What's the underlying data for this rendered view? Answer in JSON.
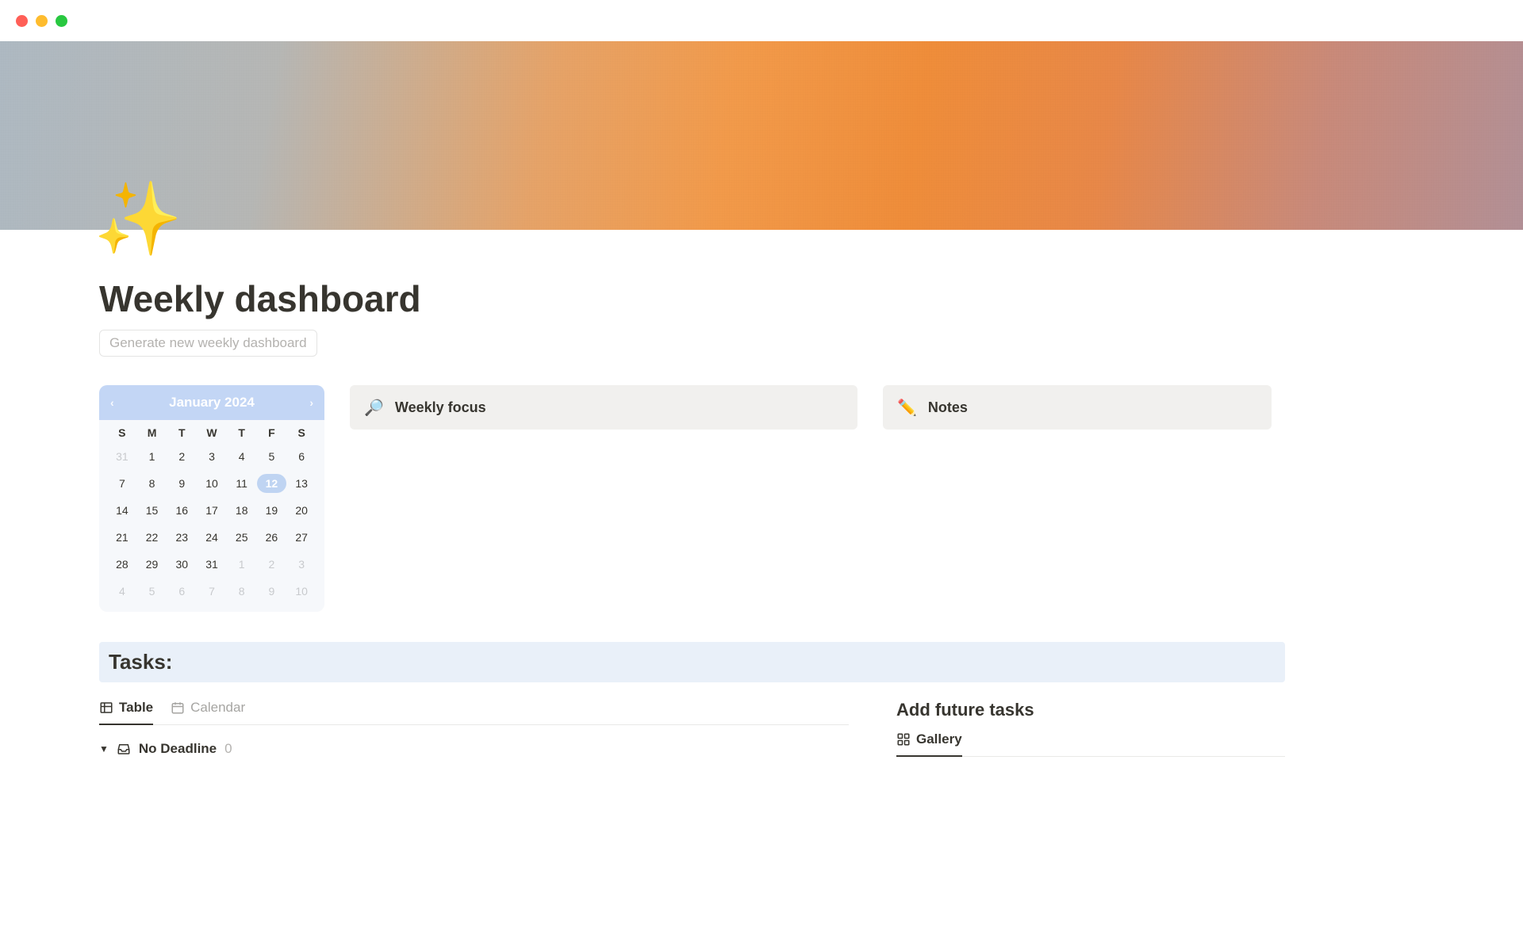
{
  "page": {
    "icon": "✨",
    "title": "Weekly dashboard",
    "generate_label": "Generate new weekly dashboard"
  },
  "calendar": {
    "month_label": "January 2024",
    "dow": [
      "S",
      "M",
      "T",
      "W",
      "T",
      "F",
      "S"
    ],
    "cells": [
      {
        "n": "31",
        "dim": true
      },
      {
        "n": "1"
      },
      {
        "n": "2"
      },
      {
        "n": "3"
      },
      {
        "n": "4"
      },
      {
        "n": "5"
      },
      {
        "n": "6"
      },
      {
        "n": "7"
      },
      {
        "n": "8"
      },
      {
        "n": "9"
      },
      {
        "n": "10"
      },
      {
        "n": "11"
      },
      {
        "n": "12",
        "today": true
      },
      {
        "n": "13"
      },
      {
        "n": "14"
      },
      {
        "n": "15"
      },
      {
        "n": "16"
      },
      {
        "n": "17"
      },
      {
        "n": "18"
      },
      {
        "n": "19"
      },
      {
        "n": "20"
      },
      {
        "n": "21"
      },
      {
        "n": "22"
      },
      {
        "n": "23"
      },
      {
        "n": "24"
      },
      {
        "n": "25"
      },
      {
        "n": "26"
      },
      {
        "n": "27"
      },
      {
        "n": "28"
      },
      {
        "n": "29"
      },
      {
        "n": "30"
      },
      {
        "n": "31"
      },
      {
        "n": "1",
        "dim": true
      },
      {
        "n": "2",
        "dim": true
      },
      {
        "n": "3",
        "dim": true
      },
      {
        "n": "4",
        "dim": true
      },
      {
        "n": "5",
        "dim": true
      },
      {
        "n": "6",
        "dim": true
      },
      {
        "n": "7",
        "dim": true
      },
      {
        "n": "8",
        "dim": true
      },
      {
        "n": "9",
        "dim": true
      },
      {
        "n": "10",
        "dim": true
      }
    ]
  },
  "cards": {
    "focus": {
      "emoji": "🔎",
      "label": "Weekly focus"
    },
    "notes": {
      "emoji": "✏️",
      "label": "Notes"
    }
  },
  "tasks": {
    "header": "Tasks:",
    "tabs": {
      "table": "Table",
      "calendar": "Calendar"
    },
    "group": {
      "label": "No Deadline",
      "count": "0"
    }
  },
  "future": {
    "title": "Add future tasks",
    "tab": "Gallery"
  }
}
